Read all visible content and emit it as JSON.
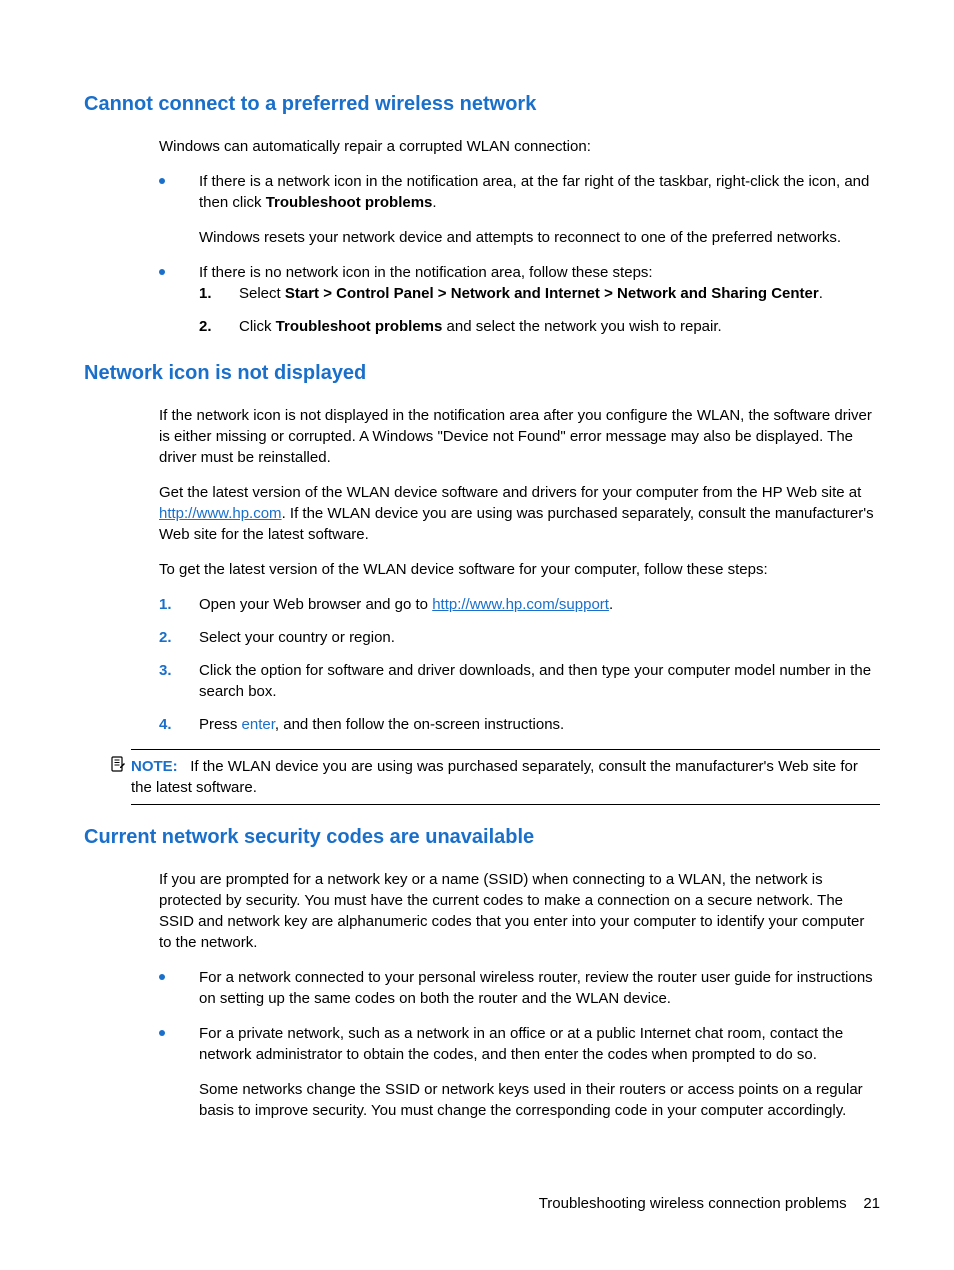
{
  "section1": {
    "heading": "Cannot connect to a preferred wireless network",
    "intro": "Windows can automatically repair a corrupted WLAN connection:",
    "bullet1_a": "If there is a network icon in the notification area, at the far right of the taskbar, right-click the icon, and then click ",
    "bullet1_bold": "Troubleshoot problems",
    "bullet1_sub": "Windows resets your network device and attempts to reconnect to one of the preferred networks.",
    "bullet2": "If there is no network icon in the notification area, follow these steps:",
    "step1_a": "Select ",
    "step1_bold": "Start > Control Panel > Network and Internet > Network and Sharing Center",
    "step2_a": "Click ",
    "step2_bold": "Troubleshoot problems",
    "step2_b": " and select the network you wish to repair."
  },
  "section2": {
    "heading": "Network icon is not displayed",
    "p1": "If the network icon is not displayed in the notification area after you configure the WLAN, the software driver is either missing or corrupted. A Windows \"Device not Found\" error message may also be displayed. The driver must be reinstalled.",
    "p2_a": "Get the latest version of the WLAN device software and drivers for your computer from the HP Web site at ",
    "p2_link": "http://www.hp.com",
    "p2_b": ". If the WLAN device you are using was purchased separately, consult the manufacturer's Web site for the latest software.",
    "p3": "To get the latest version of the WLAN device software for your computer, follow these steps:",
    "step1_a": "Open your Web browser and go to ",
    "step1_link": "http://www.hp.com/support",
    "step2": "Select your country or region.",
    "step3": "Click the option for software and driver downloads, and then type your computer model number in the search box.",
    "step4_a": "Press ",
    "step4_enter": "enter",
    "step4_b": ", and then follow the on-screen instructions.",
    "note_label": "NOTE:",
    "note_text": "If the WLAN device you are using was purchased separately, consult the manufacturer's Web site for the latest software."
  },
  "section3": {
    "heading": "Current network security codes are unavailable",
    "p1": "If you are prompted for a network key or a name (SSID) when connecting to a WLAN, the network is protected by security. You must have the current codes to make a connection on a secure network. The SSID and network key are alphanumeric codes that you enter into your computer to identify your computer to the network.",
    "bullet1": "For a network connected to your personal wireless router, review the router user guide for instructions on setting up the same codes on both the router and the WLAN device.",
    "bullet2": "For a private network, such as a network in an office or at a public Internet chat room, contact the network administrator to obtain the codes, and then enter the codes when prompted to do so.",
    "bullet2_sub": "Some networks change the SSID or network keys used in their routers or access points on a regular basis to improve security. You must change the corresponding code in your computer accordingly."
  },
  "footer": {
    "title": "Troubleshooting wireless connection problems",
    "page": "21"
  }
}
